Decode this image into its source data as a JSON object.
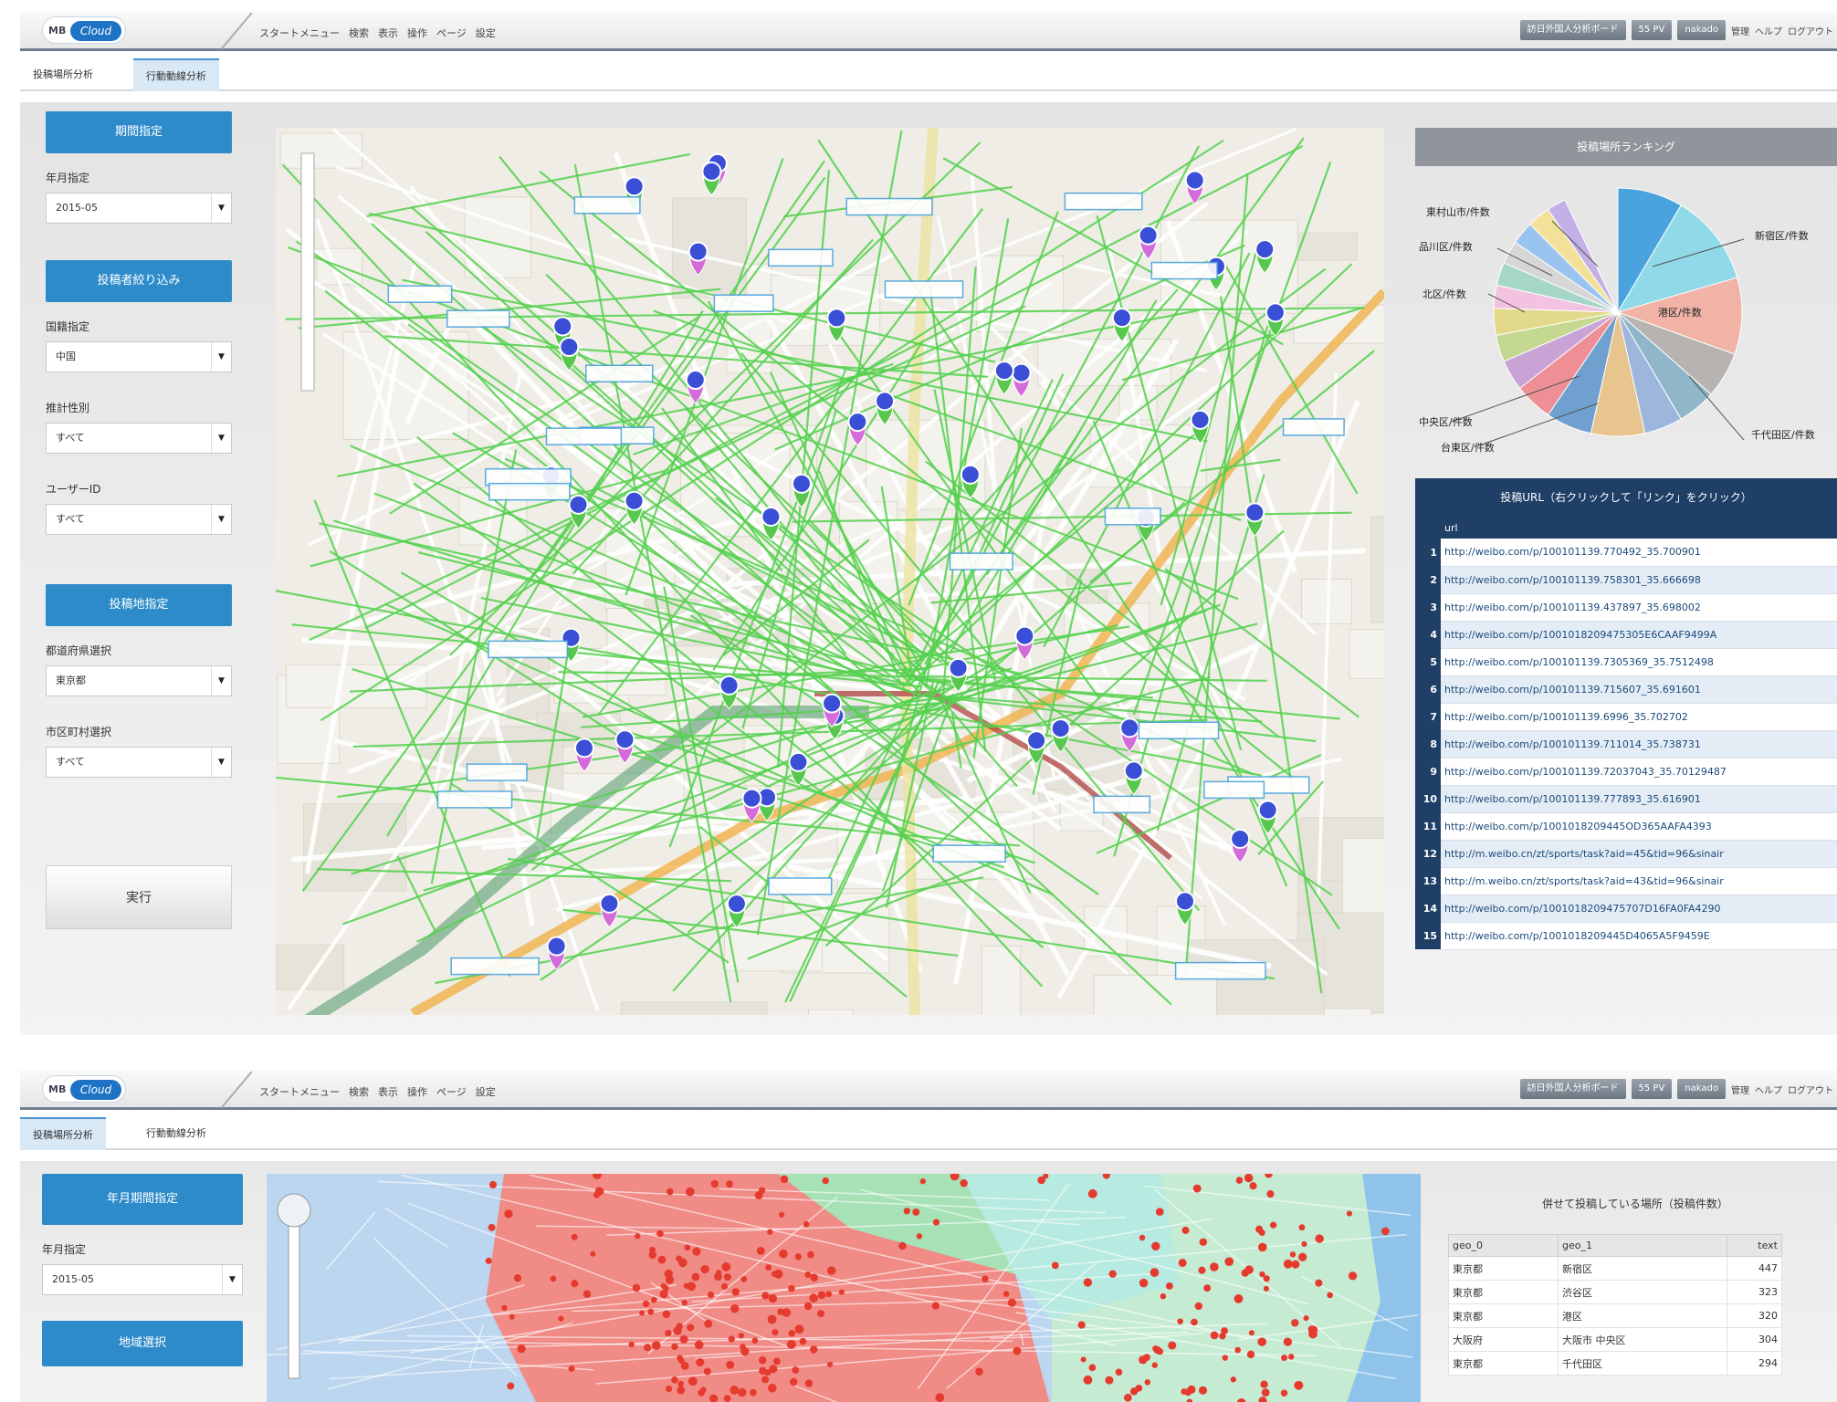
{
  "app": {
    "logo_mb": "MB",
    "logo_cloud": "Cloud",
    "menu": [
      "スタートメニュー",
      "検索",
      "表示",
      "操作",
      "ページ",
      "設定"
    ],
    "right_buttons": [
      "訪日外国人分析ボード",
      "55 PV",
      "nakado"
    ],
    "right_links": [
      "管理",
      "ヘルプ",
      "ログアウト"
    ]
  },
  "screen1": {
    "tabs": [
      "投稿場所分析",
      "行動動線分析"
    ],
    "active_tab": 1,
    "sidebar": {
      "period_header": "期間指定",
      "month_label": "年月指定",
      "month_value": "2015-05",
      "poster_header": "投稿者絞り込み",
      "country_label": "国籍指定",
      "country_value": "中国",
      "gender_label": "推計性別",
      "gender_value": "すべて",
      "user_label": "ユーザーID",
      "user_value": "すべて",
      "place_header": "投稿地指定",
      "pref_label": "都道府県選択",
      "pref_value": "東京都",
      "city_label": "市区町村選択",
      "city_value": "すべて",
      "execute_label": "実行"
    },
    "ranking_title": "投稿場所ランキング",
    "pie_labels": [
      "東村山市/件数",
      "品川区/件数",
      "北区/件数",
      "中央区/件数",
      "台東区/件数",
      "新宿区/件数",
      "港区/件数",
      "千代田区/件数"
    ],
    "pie_colors": [
      "#4aa3df",
      "#8fd9e8",
      "#f0b3a6",
      "#b6b3b0",
      "#8fb6c9",
      "#9db7dc",
      "#e8c48f",
      "#6fa0d0",
      "#ee8f96",
      "#c9a3d6",
      "#c4d98f",
      "#e3d98a",
      "#f2c2e0",
      "#a6d6c8",
      "#d6d6d6",
      "#9ac4f0",
      "#f3e19a",
      "#c2b0e6"
    ],
    "url_table_title": "投稿URL（右クリックして「リンク」をクリック）",
    "url_column": "url",
    "urls": [
      "http://weibo.com/p/100101139.770492_35.700901",
      "http://weibo.com/p/100101139.758301_35.666698",
      "http://weibo.com/p/100101139.437897_35.698002",
      "http://weibo.com/p/1001018209475305E6CAAF9499A",
      "http://weibo.com/p/100101139.7305369_35.7512498",
      "http://weibo.com/p/100101139.715607_35.691601",
      "http://weibo.com/p/100101139.6996_35.702702",
      "http://weibo.com/p/100101139.711014_35.738731",
      "http://weibo.com/p/100101139.72037043_35.70129487",
      "http://weibo.com/p/100101139.777893_35.616901",
      "http://weibo.com/p/1001018209445OD365AAFA4393",
      "http://m.weibo.cn/zt/sports/task?aid=45&tid=96&sinair",
      "http://m.weibo.cn/zt/sports/task?aid=43&tid=96&sinair",
      "http://weibo.com/p/1001018209475707D16FA0FA4290",
      "http://weibo.com/p/1001018209445D4065A5F9459E"
    ]
  },
  "screen2": {
    "tabs": [
      "投稿場所分析",
      "行動動線分析"
    ],
    "active_tab": 0,
    "sidebar": {
      "header1": "年月期間指定",
      "month_label": "年月指定",
      "month_value": "2015-05",
      "header2": "地域選択"
    },
    "table_title": "併せて投稿している場所（投稿件数）",
    "columns": [
      "geo_0",
      "geo_1",
      "text"
    ],
    "rows": [
      {
        "geo_0": "東京都",
        "geo_1": "新宿区",
        "text": "447"
      },
      {
        "geo_0": "東京都",
        "geo_1": "渋谷区",
        "text": "323"
      },
      {
        "geo_0": "東京都",
        "geo_1": "港区",
        "text": "320"
      },
      {
        "geo_0": "大阪府",
        "geo_1": "大阪市 中央区",
        "text": "304"
      },
      {
        "geo_0": "東京都",
        "geo_1": "千代田区",
        "text": "294"
      }
    ]
  }
}
